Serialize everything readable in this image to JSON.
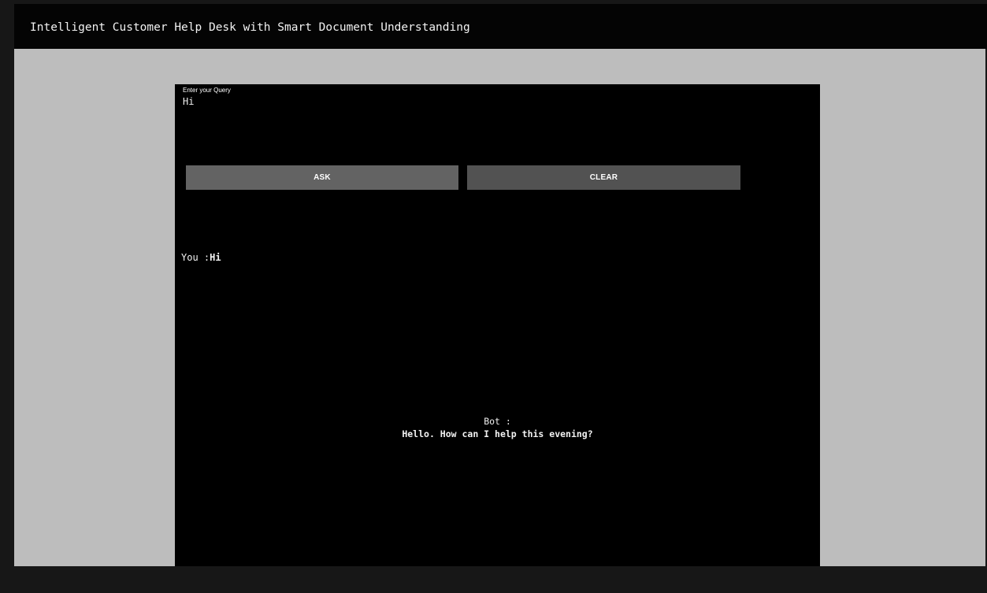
{
  "header": {
    "title": "Intelligent Customer Help Desk with Smart Document Understanding"
  },
  "query": {
    "label": "Enter your Query",
    "value": "Hi"
  },
  "buttons": {
    "ask_label": "ASK",
    "clear_label": "CLEAR"
  },
  "conversation": {
    "user_prefix": "You :",
    "user_text": "Hi",
    "bot_prefix": "Bot :",
    "bot_text": "Hello. How can I help this evening?"
  },
  "colors": {
    "header_background": "#040404",
    "page_background": "#bdbdbd",
    "panel_background": "#000000",
    "ask_button": "#636363",
    "clear_button": "#525252"
  }
}
